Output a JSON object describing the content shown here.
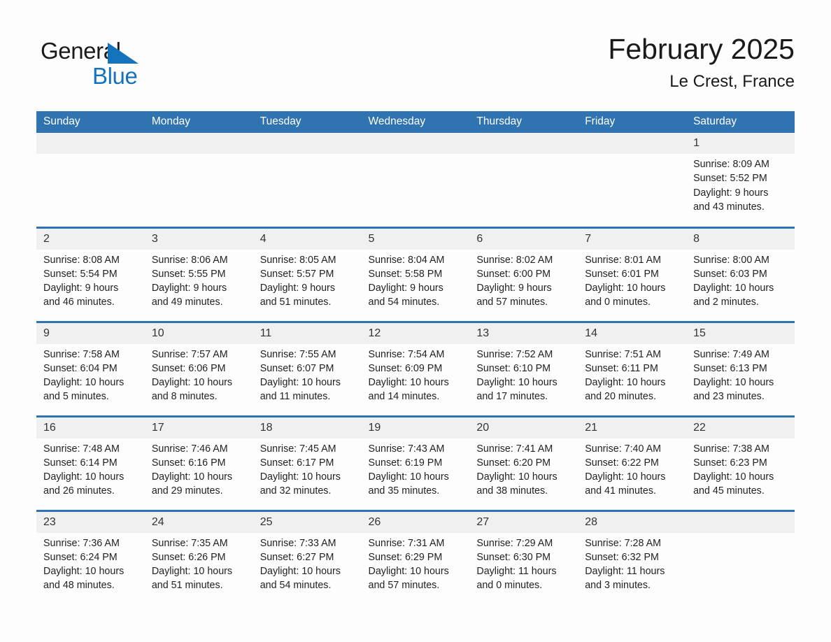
{
  "brand": {
    "word1": "General",
    "word2": "Blue",
    "triangle_icon": "triangle-logo-icon",
    "accent_color": "#1473bd"
  },
  "header": {
    "title": "February 2025",
    "subtitle": "Le Crest, France",
    "header_bg_color": "#2f73b0",
    "daynum_bg_color": "#f0f0f0"
  },
  "calendar": {
    "weekdays": [
      "Sunday",
      "Monday",
      "Tuesday",
      "Wednesday",
      "Thursday",
      "Friday",
      "Saturday"
    ],
    "weeks": [
      [
        {
          "day": "",
          "empty": true
        },
        {
          "day": "",
          "empty": true
        },
        {
          "day": "",
          "empty": true
        },
        {
          "day": "",
          "empty": true
        },
        {
          "day": "",
          "empty": true
        },
        {
          "day": "",
          "empty": true
        },
        {
          "day": "1",
          "sunrise": "Sunrise: 8:09 AM",
          "sunset": "Sunset: 5:52 PM",
          "daylight1": "Daylight: 9 hours",
          "daylight2": "and 43 minutes."
        }
      ],
      [
        {
          "day": "2",
          "sunrise": "Sunrise: 8:08 AM",
          "sunset": "Sunset: 5:54 PM",
          "daylight1": "Daylight: 9 hours",
          "daylight2": "and 46 minutes."
        },
        {
          "day": "3",
          "sunrise": "Sunrise: 8:06 AM",
          "sunset": "Sunset: 5:55 PM",
          "daylight1": "Daylight: 9 hours",
          "daylight2": "and 49 minutes."
        },
        {
          "day": "4",
          "sunrise": "Sunrise: 8:05 AM",
          "sunset": "Sunset: 5:57 PM",
          "daylight1": "Daylight: 9 hours",
          "daylight2": "and 51 minutes."
        },
        {
          "day": "5",
          "sunrise": "Sunrise: 8:04 AM",
          "sunset": "Sunset: 5:58 PM",
          "daylight1": "Daylight: 9 hours",
          "daylight2": "and 54 minutes."
        },
        {
          "day": "6",
          "sunrise": "Sunrise: 8:02 AM",
          "sunset": "Sunset: 6:00 PM",
          "daylight1": "Daylight: 9 hours",
          "daylight2": "and 57 minutes."
        },
        {
          "day": "7",
          "sunrise": "Sunrise: 8:01 AM",
          "sunset": "Sunset: 6:01 PM",
          "daylight1": "Daylight: 10 hours",
          "daylight2": "and 0 minutes."
        },
        {
          "day": "8",
          "sunrise": "Sunrise: 8:00 AM",
          "sunset": "Sunset: 6:03 PM",
          "daylight1": "Daylight: 10 hours",
          "daylight2": "and 2 minutes."
        }
      ],
      [
        {
          "day": "9",
          "sunrise": "Sunrise: 7:58 AM",
          "sunset": "Sunset: 6:04 PM",
          "daylight1": "Daylight: 10 hours",
          "daylight2": "and 5 minutes."
        },
        {
          "day": "10",
          "sunrise": "Sunrise: 7:57 AM",
          "sunset": "Sunset: 6:06 PM",
          "daylight1": "Daylight: 10 hours",
          "daylight2": "and 8 minutes."
        },
        {
          "day": "11",
          "sunrise": "Sunrise: 7:55 AM",
          "sunset": "Sunset: 6:07 PM",
          "daylight1": "Daylight: 10 hours",
          "daylight2": "and 11 minutes."
        },
        {
          "day": "12",
          "sunrise": "Sunrise: 7:54 AM",
          "sunset": "Sunset: 6:09 PM",
          "daylight1": "Daylight: 10 hours",
          "daylight2": "and 14 minutes."
        },
        {
          "day": "13",
          "sunrise": "Sunrise: 7:52 AM",
          "sunset": "Sunset: 6:10 PM",
          "daylight1": "Daylight: 10 hours",
          "daylight2": "and 17 minutes."
        },
        {
          "day": "14",
          "sunrise": "Sunrise: 7:51 AM",
          "sunset": "Sunset: 6:11 PM",
          "daylight1": "Daylight: 10 hours",
          "daylight2": "and 20 minutes."
        },
        {
          "day": "15",
          "sunrise": "Sunrise: 7:49 AM",
          "sunset": "Sunset: 6:13 PM",
          "daylight1": "Daylight: 10 hours",
          "daylight2": "and 23 minutes."
        }
      ],
      [
        {
          "day": "16",
          "sunrise": "Sunrise: 7:48 AM",
          "sunset": "Sunset: 6:14 PM",
          "daylight1": "Daylight: 10 hours",
          "daylight2": "and 26 minutes."
        },
        {
          "day": "17",
          "sunrise": "Sunrise: 7:46 AM",
          "sunset": "Sunset: 6:16 PM",
          "daylight1": "Daylight: 10 hours",
          "daylight2": "and 29 minutes."
        },
        {
          "day": "18",
          "sunrise": "Sunrise: 7:45 AM",
          "sunset": "Sunset: 6:17 PM",
          "daylight1": "Daylight: 10 hours",
          "daylight2": "and 32 minutes."
        },
        {
          "day": "19",
          "sunrise": "Sunrise: 7:43 AM",
          "sunset": "Sunset: 6:19 PM",
          "daylight1": "Daylight: 10 hours",
          "daylight2": "and 35 minutes."
        },
        {
          "day": "20",
          "sunrise": "Sunrise: 7:41 AM",
          "sunset": "Sunset: 6:20 PM",
          "daylight1": "Daylight: 10 hours",
          "daylight2": "and 38 minutes."
        },
        {
          "day": "21",
          "sunrise": "Sunrise: 7:40 AM",
          "sunset": "Sunset: 6:22 PM",
          "daylight1": "Daylight: 10 hours",
          "daylight2": "and 41 minutes."
        },
        {
          "day": "22",
          "sunrise": "Sunrise: 7:38 AM",
          "sunset": "Sunset: 6:23 PM",
          "daylight1": "Daylight: 10 hours",
          "daylight2": "and 45 minutes."
        }
      ],
      [
        {
          "day": "23",
          "sunrise": "Sunrise: 7:36 AM",
          "sunset": "Sunset: 6:24 PM",
          "daylight1": "Daylight: 10 hours",
          "daylight2": "and 48 minutes."
        },
        {
          "day": "24",
          "sunrise": "Sunrise: 7:35 AM",
          "sunset": "Sunset: 6:26 PM",
          "daylight1": "Daylight: 10 hours",
          "daylight2": "and 51 minutes."
        },
        {
          "day": "25",
          "sunrise": "Sunrise: 7:33 AM",
          "sunset": "Sunset: 6:27 PM",
          "daylight1": "Daylight: 10 hours",
          "daylight2": "and 54 minutes."
        },
        {
          "day": "26",
          "sunrise": "Sunrise: 7:31 AM",
          "sunset": "Sunset: 6:29 PM",
          "daylight1": "Daylight: 10 hours",
          "daylight2": "and 57 minutes."
        },
        {
          "day": "27",
          "sunrise": "Sunrise: 7:29 AM",
          "sunset": "Sunset: 6:30 PM",
          "daylight1": "Daylight: 11 hours",
          "daylight2": "and 0 minutes."
        },
        {
          "day": "28",
          "sunrise": "Sunrise: 7:28 AM",
          "sunset": "Sunset: 6:32 PM",
          "daylight1": "Daylight: 11 hours",
          "daylight2": "and 3 minutes."
        },
        {
          "day": "",
          "empty": true
        }
      ]
    ]
  }
}
